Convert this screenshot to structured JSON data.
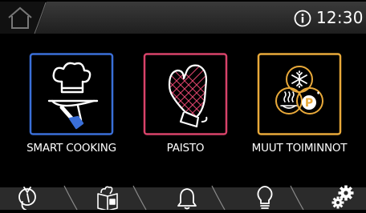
{
  "status_bar": {
    "time": "12:30",
    "home_icon": "home-icon",
    "info_icon": "info-icon"
  },
  "tiles": [
    {
      "label": "SMART COOKING",
      "icon": "chef-serving-icon",
      "color": "#3a6fd8"
    },
    {
      "label": "PAISTO",
      "icon": "oven-mitt-icon",
      "color": "#d8436a"
    },
    {
      "label": "MUUT TOIMINNOT",
      "icon": "other-functions-icon",
      "color": "#e8a93a"
    }
  ],
  "bottom_nav": [
    {
      "icon": "timer-icon"
    },
    {
      "icon": "recipe-book-icon"
    },
    {
      "icon": "bell-icon"
    },
    {
      "icon": "light-bulb-icon"
    },
    {
      "icon": "settings-gear-icon"
    }
  ],
  "colors": {
    "background": "#000000",
    "bar": "#2a2a2a",
    "text": "#ffffff"
  }
}
